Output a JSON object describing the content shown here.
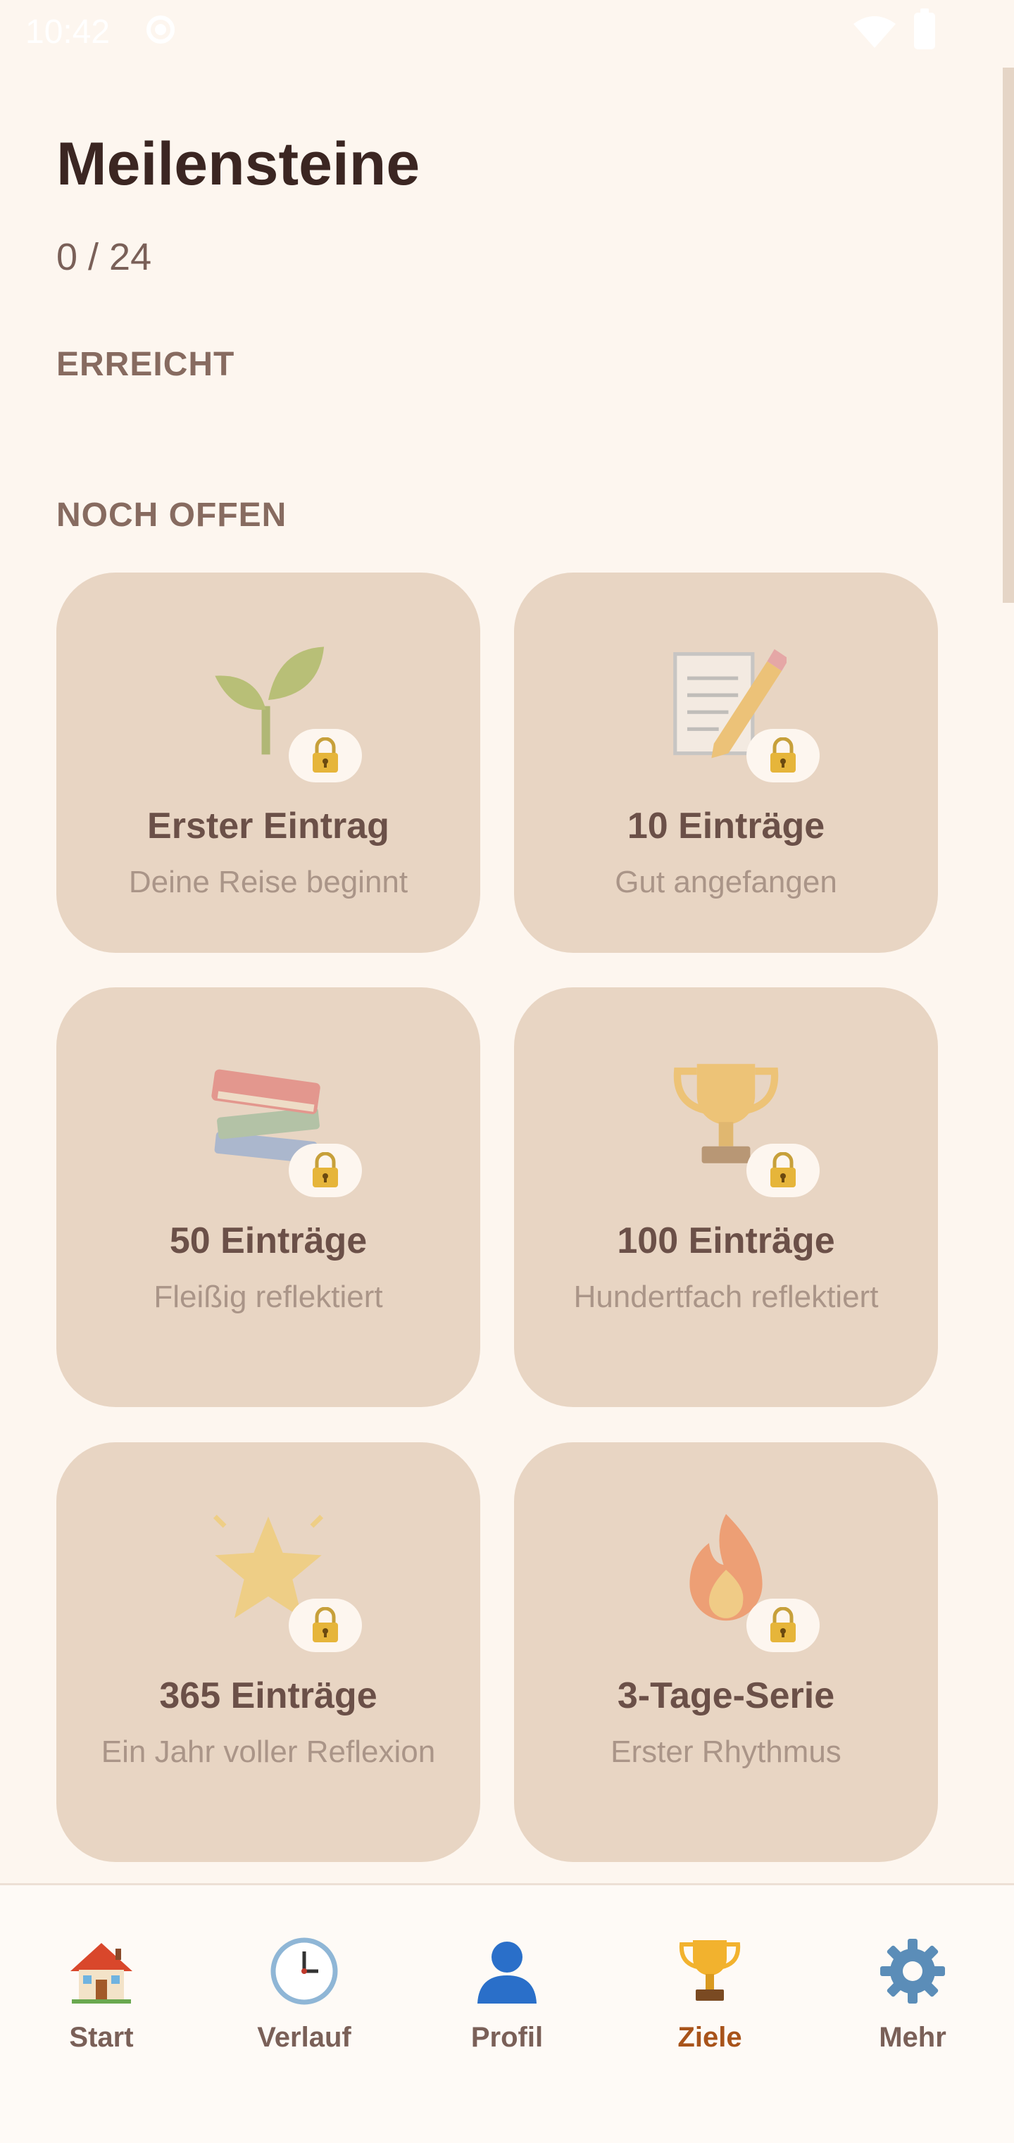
{
  "status_bar": {
    "time": "10:42",
    "icons": [
      "wifi-icon",
      "battery-icon"
    ]
  },
  "header": {
    "title": "Meilensteine",
    "progress": "0 / 24"
  },
  "sections": {
    "achieved_label": "ERREICHT",
    "open_label": "NOCH OFFEN"
  },
  "milestones": [
    {
      "title": "Erster Eintrag",
      "subtitle": "Deine Reise beginnt",
      "icon": "seedling-icon",
      "locked": true
    },
    {
      "title": "10 Einträge",
      "subtitle": "Gut angefangen",
      "icon": "memo-icon",
      "locked": true
    },
    {
      "title": "50 Einträge",
      "subtitle": "Fleißig reflektiert",
      "icon": "books-icon",
      "locked": true
    },
    {
      "title": "100 Einträge",
      "subtitle": "Hundertfach reflektiert",
      "icon": "trophy-icon",
      "locked": true
    },
    {
      "title": "365 Einträge",
      "subtitle": "Ein Jahr voller Reflexion",
      "icon": "star-icon",
      "locked": true
    },
    {
      "title": "3-Tage-Serie",
      "subtitle": "Erster Rhythmus",
      "icon": "fire-icon",
      "locked": true
    }
  ],
  "nav": {
    "items": [
      {
        "label": "Start",
        "icon": "house-icon",
        "active": false
      },
      {
        "label": "Verlauf",
        "icon": "clock-icon",
        "active": false
      },
      {
        "label": "Profil",
        "icon": "person-icon",
        "active": false
      },
      {
        "label": "Ziele",
        "icon": "trophy-icon",
        "active": true
      },
      {
        "label": "Mehr",
        "icon": "gear-icon",
        "active": false
      }
    ]
  },
  "colors": {
    "background": "#fdf6ef",
    "card": "#e8d5c3",
    "title": "#3b2622",
    "active_nav": "#a8531a"
  }
}
